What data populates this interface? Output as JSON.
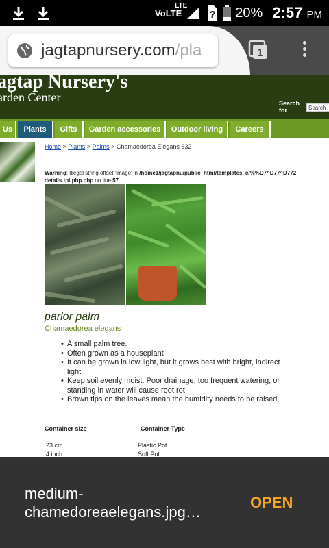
{
  "status_bar": {
    "network": "VoLTE",
    "network_sup": "LTE",
    "battery": "20%",
    "time": "2:57",
    "ampm": "PM"
  },
  "browser": {
    "url_main": "jagtapnursery.com",
    "url_rest": "/pla",
    "tab_count": "1"
  },
  "site": {
    "title": "agtap Nursery's",
    "subtitle": "arden Center",
    "search_label_1": "Search",
    "search_label_2": "for",
    "search_placeholder": "Search",
    "nav": [
      "Us",
      "Plants",
      "Gifts",
      "Garden accessories",
      "Outdoor living",
      "Careers"
    ]
  },
  "breadcrumb": {
    "home": "Home",
    "sep": " > ",
    "plants": "Plants",
    "palms": "Palms",
    "current": " > Chamaedorea Elegans 632"
  },
  "warning": {
    "label": "Warning",
    "text": ": Illegal string offset 'image' in ",
    "path": "/home1/jagtapnu/public_html/templates_c/%%D7^D77^D772",
    "path2": "details.tpl.php.php",
    "line_text": " on line ",
    "line_no": "57"
  },
  "plant": {
    "common_name": "parlor palm",
    "scientific_name": "Chamaedorea elegans",
    "bullets": [
      "A small palm tree.",
      "Often grown as a houseplant",
      "It can be grown in low light, but it grows best with bright, indirect light.",
      "Keep soil evenly moist. Poor drainage, too frequent watering, or standing in water will cause root rot",
      "Brown tips on the leaves mean the humidity needs to be raised,"
    ]
  },
  "container_table": {
    "headers": [
      "Container size",
      "Container Type"
    ],
    "rows": [
      [
        "23 cm",
        "Plastic Pot"
      ],
      [
        "4 inch",
        "Soft Pot"
      ]
    ]
  },
  "download": {
    "filename": "medium-chamedoreaelegans.jpg…",
    "action": "OPEN"
  },
  "colors": {
    "header_bg": "#2a3d12",
    "nav_bg": "#7fad2b",
    "nav_active": "#1e5a7a",
    "open_accent": "#f5a623"
  }
}
